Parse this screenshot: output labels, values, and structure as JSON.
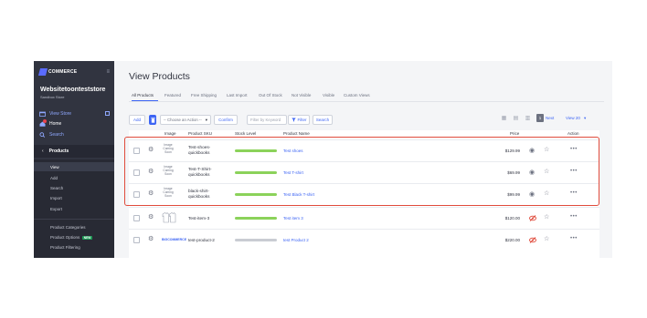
{
  "colors": {
    "accent": "#3c64f4",
    "sidebar": "#313440",
    "stock_green": "#8bd25a",
    "stock_gray": "#c9ccd3",
    "highlight": "#e04b3c",
    "eye_hidden": "#e04b3c"
  },
  "sidebar": {
    "brand": "COMMERCE",
    "store_name": "Websitetoonteststore",
    "store_sub": "Sandbox Store",
    "links": {
      "view_store": "View Store",
      "home": "Home",
      "search": "Search"
    },
    "section": "Products",
    "submenu": [
      "View",
      "Add",
      "Search",
      "Import",
      "Export"
    ],
    "submenu2": [
      "Product Categories",
      "Product Options",
      "Product Filtering"
    ],
    "new_badge": "NEW"
  },
  "main": {
    "title": "View Products",
    "tabs": [
      "All Products",
      "Featured",
      "Free Shipping",
      "Last Import",
      "Out Of Stock",
      "Not Visible",
      "Visible",
      "Custom Views"
    ]
  },
  "toolbar": {
    "add": "Add",
    "action_select": "-- Choose an Action --",
    "confirm": "Confirm",
    "filter_placeholder": "Filter by Keyword",
    "filter": "Filter",
    "search": "Search",
    "page": "1",
    "next": "Next",
    "view": "View 20"
  },
  "table": {
    "headers": {
      "image": "Image",
      "sku": "Product SKU",
      "stock": "Stock Level",
      "name": "Product Name",
      "price": "Price",
      "action": "Action"
    },
    "image_placeholder": "Image\nComing\nSoon",
    "logo_text": "BIGCOMMERCE",
    "rows": [
      {
        "image": "placeholder",
        "sku": "Test-shoes-quickbooks",
        "stock": "green",
        "name": "Test shoes",
        "price": "$129.99",
        "visible": true
      },
      {
        "image": "placeholder",
        "sku": "Test-T-Shirt-quickbooks",
        "stock": "green",
        "name": "Test T-shirt",
        "price": "$69.99",
        "visible": true
      },
      {
        "image": "placeholder",
        "sku": "black-shirt-quickbooks",
        "stock": "green",
        "name": "Test Black T-shirt",
        "price": "$99.99",
        "visible": true
      },
      {
        "image": "shirt",
        "sku": "Test-item-3",
        "stock": "green",
        "name": "Test item 3",
        "price": "$120.00",
        "visible": false
      },
      {
        "image": "logo",
        "sku": "test-product-2",
        "stock": "gray",
        "name": "test Product 2",
        "price": "$220.00",
        "visible": false
      }
    ]
  }
}
